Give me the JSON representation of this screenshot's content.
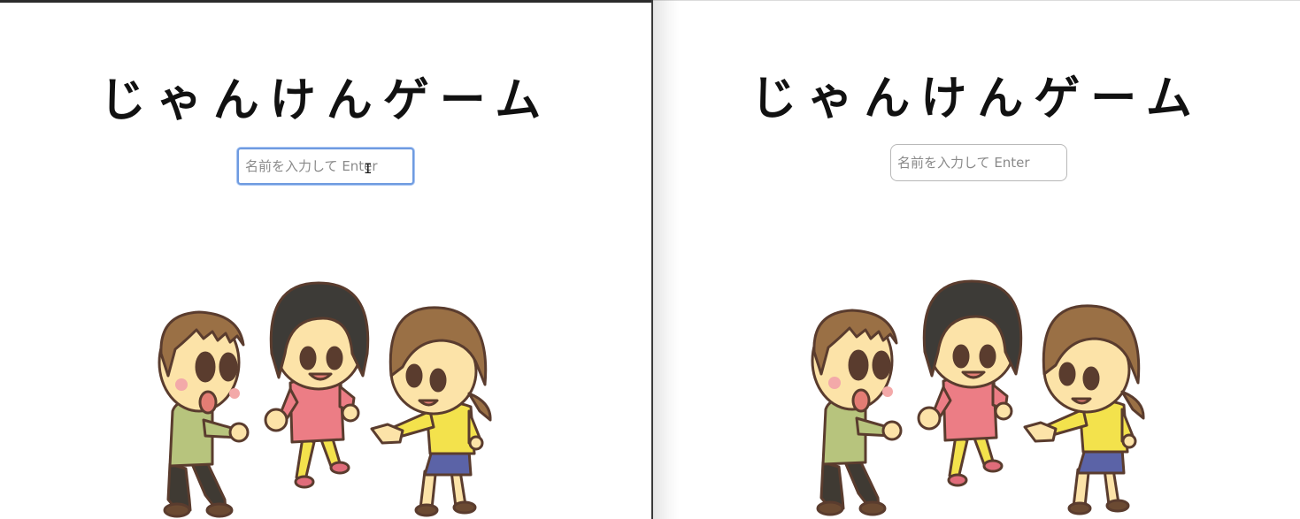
{
  "game": {
    "title": "じゃんけんゲーム",
    "name_placeholder": "名前を入力して Enter"
  },
  "illustration": {
    "subject": "three children playing rock-paper-scissors",
    "icon": "kids-janken-illustration"
  }
}
